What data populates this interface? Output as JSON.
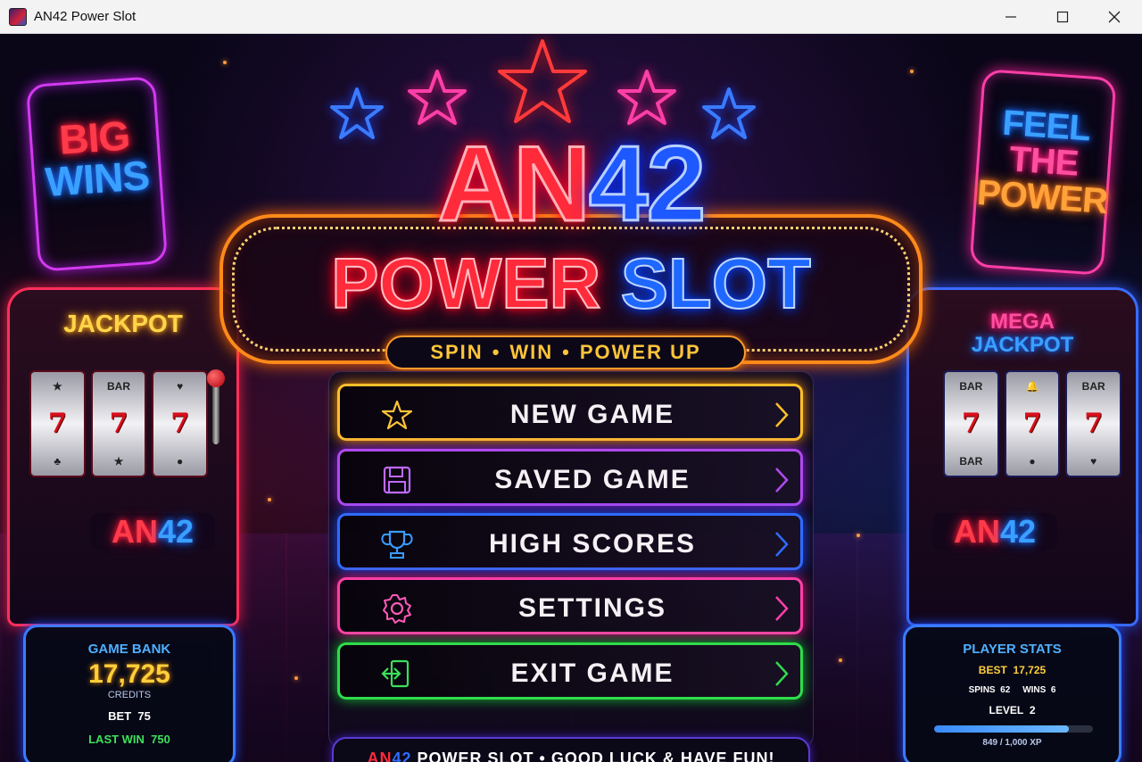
{
  "window": {
    "title": "AN42 Power Slot",
    "controls": {
      "minimize_icon": "minimize-icon",
      "maximize_icon": "maximize-icon",
      "close_icon": "close-icon"
    }
  },
  "signs": {
    "left": {
      "line1": "BIG",
      "line2": "WINS"
    },
    "right": {
      "line1": "FEEL",
      "line2": "THE",
      "line3": "POWER"
    }
  },
  "machines": {
    "left": {
      "title": "JACKPOT",
      "logo_a": "AN",
      "logo_b": "42"
    },
    "right": {
      "title_line1": "MEGA",
      "title_line2": "JACKPOT",
      "logo_a": "AN",
      "logo_b": "42"
    }
  },
  "logo": {
    "part1": "AN",
    "part2": "42",
    "line2_part1": "POWER",
    "line2_part2": "SLOT",
    "tagline": [
      "SPIN",
      "WIN",
      "POWER UP"
    ],
    "tagline_separator": "•"
  },
  "menu": {
    "new_game": {
      "label": "NEW GAME",
      "icon": "star-icon"
    },
    "saved_game": {
      "label": "SAVED GAME",
      "icon": "floppy-disk-icon"
    },
    "high_scores": {
      "label": "HIGH SCORES",
      "icon": "trophy-icon"
    },
    "settings": {
      "label": "SETTINGS",
      "icon": "gear-icon"
    },
    "exit_game": {
      "label": "EXIT GAME",
      "icon": "exit-door-icon"
    }
  },
  "footer": {
    "brand_a": "AN",
    "brand_b": "42",
    "text": " POWER SLOT  •  GOOD LUCK & HAVE FUN!"
  },
  "game_bank": {
    "title": "GAME BANK",
    "credits": "17,725",
    "credits_unit": "CREDITS",
    "bet_label": "BET",
    "bet_value": "75",
    "last_win_label": "LAST WIN",
    "last_win_value": "750"
  },
  "player_stats": {
    "title": "PLAYER STATS",
    "best_label": "BEST",
    "best_value": "17,725",
    "spins_label": "SPINS",
    "spins_value": "62",
    "wins_label": "WINS",
    "wins_value": "6",
    "level_label": "LEVEL",
    "level_value": "2",
    "xp_text": "849 / 1,000 XP",
    "xp_fraction": 0.849
  },
  "colors": {
    "neon_red": "#ff2a3a",
    "neon_blue": "#1e58ff",
    "neon_orange": "#ff8a1a",
    "new_game_border": "#ffbf2a",
    "saved_game_border": "#b04af0",
    "high_scores_border": "#2f6bff",
    "settings_border": "#ff3fa8",
    "exit_game_border": "#2fdc4a"
  }
}
